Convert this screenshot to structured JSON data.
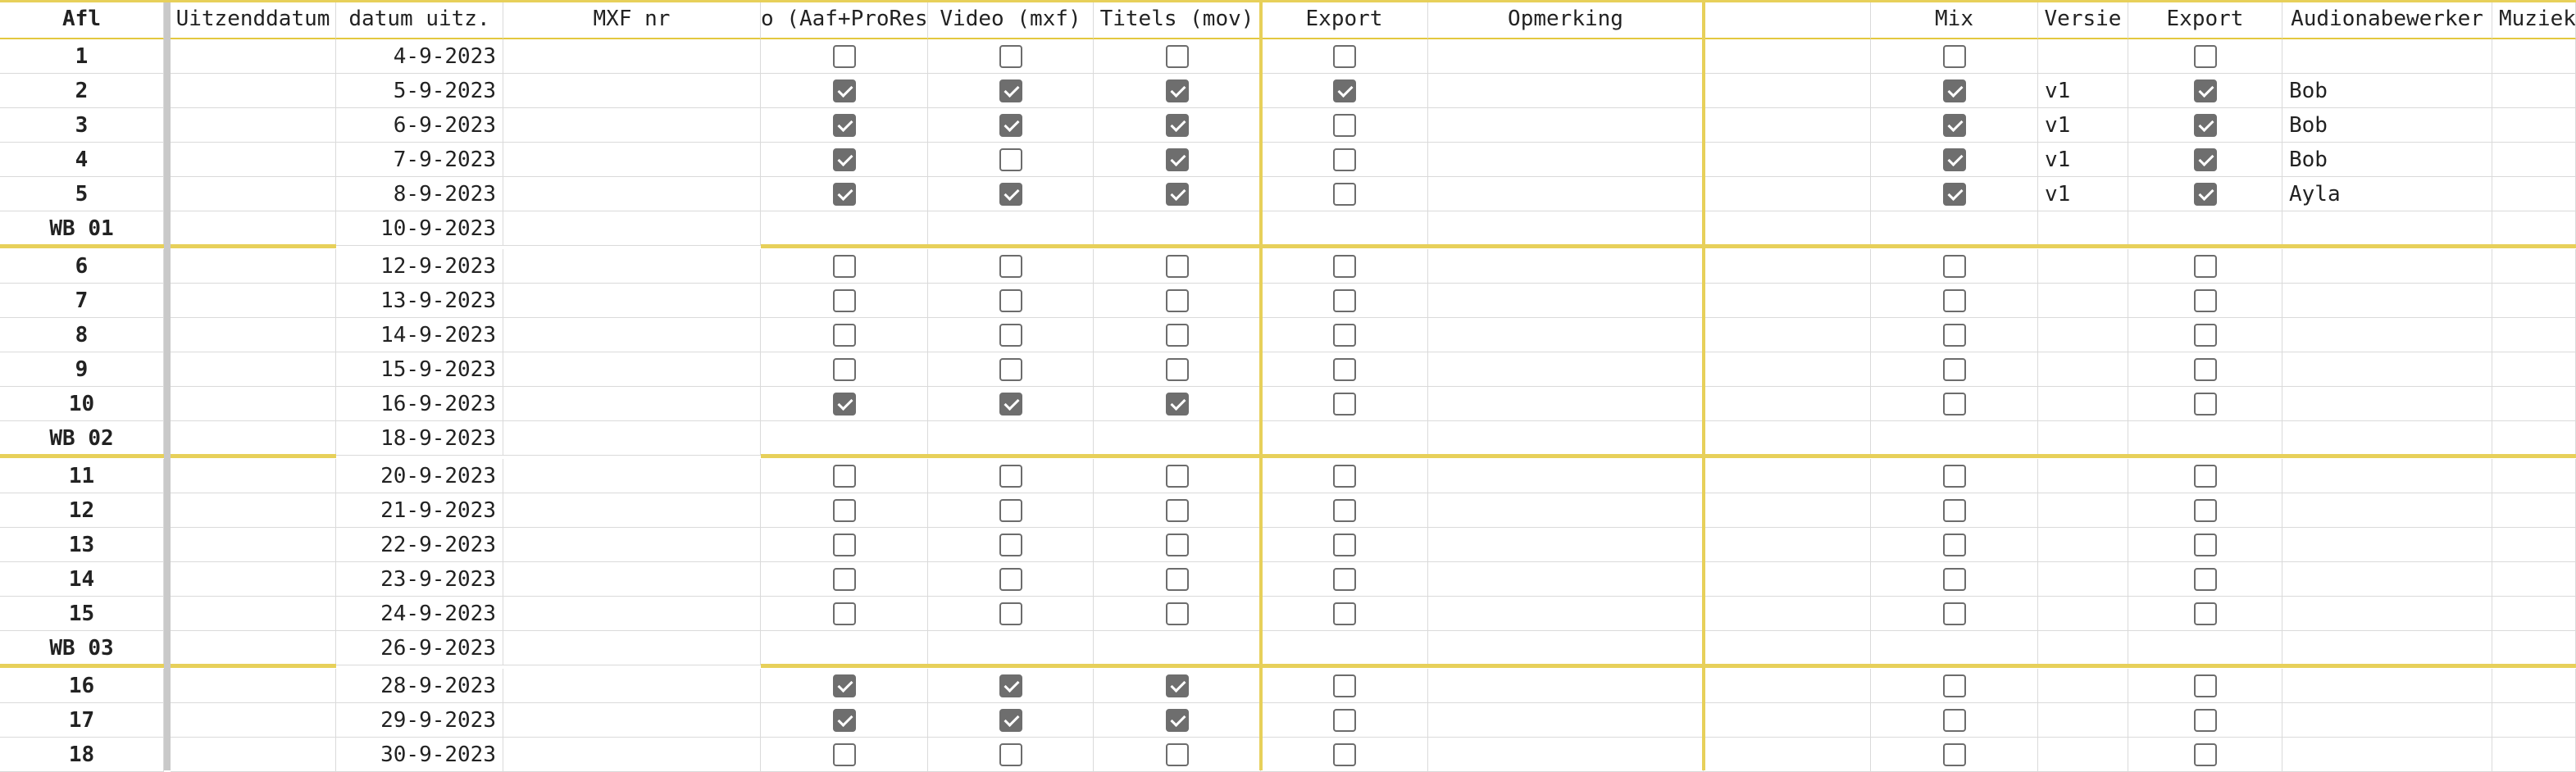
{
  "columns": [
    {
      "key": "afl",
      "label": "Afl",
      "bold": true
    },
    {
      "key": "uitzenddatum",
      "label": "Uitzenddatum"
    },
    {
      "key": "datum_uitz",
      "label": "datum uitz."
    },
    {
      "key": "mxf_nr",
      "label": "MXF nr"
    },
    {
      "key": "aaf",
      "label": "o (Aaf+ProRes"
    },
    {
      "key": "video",
      "label": "Video (mxf)"
    },
    {
      "key": "titels",
      "label": "Titels (mov)"
    },
    {
      "key": "export1",
      "label": "Export"
    },
    {
      "key": "opmerking",
      "label": "Opmerking"
    },
    {
      "key": "blank1",
      "label": ""
    },
    {
      "key": "mix",
      "label": "Mix"
    },
    {
      "key": "versie",
      "label": "Versie"
    },
    {
      "key": "export2",
      "label": "Export"
    },
    {
      "key": "audio",
      "label": "Audionabewerker"
    },
    {
      "key": "muziek",
      "label": "Muziek"
    }
  ],
  "rows": [
    {
      "type": "ep",
      "afl": "1",
      "datum": "4-9-2023",
      "aaf": false,
      "video": false,
      "titels": false,
      "export1": false,
      "mix": false,
      "versie": "",
      "export2": false,
      "audio": ""
    },
    {
      "type": "ep",
      "afl": "2",
      "datum": "5-9-2023",
      "aaf": true,
      "video": true,
      "titels": true,
      "export1": true,
      "mix": true,
      "versie": "v1",
      "export2": true,
      "audio": "Bob"
    },
    {
      "type": "ep",
      "afl": "3",
      "datum": "6-9-2023",
      "aaf": true,
      "video": true,
      "titels": true,
      "export1": false,
      "mix": true,
      "versie": "v1",
      "export2": true,
      "audio": "Bob"
    },
    {
      "type": "ep",
      "afl": "4",
      "datum": "7-9-2023",
      "aaf": true,
      "video": false,
      "titels": true,
      "export1": false,
      "mix": true,
      "versie": "v1",
      "export2": true,
      "audio": "Bob"
    },
    {
      "type": "ep",
      "afl": "5",
      "datum": "8-9-2023",
      "aaf": true,
      "video": true,
      "titels": true,
      "export1": false,
      "mix": true,
      "versie": "v1",
      "export2": true,
      "audio": "Ayla"
    },
    {
      "type": "wb",
      "afl": "WB 01",
      "datum": "10-9-2023"
    },
    {
      "type": "ep",
      "afl": "6",
      "datum": "12-9-2023",
      "aaf": false,
      "video": false,
      "titels": false,
      "export1": false,
      "mix": false,
      "versie": "",
      "export2": false,
      "audio": ""
    },
    {
      "type": "ep",
      "afl": "7",
      "datum": "13-9-2023",
      "aaf": false,
      "video": false,
      "titels": false,
      "export1": false,
      "mix": false,
      "versie": "",
      "export2": false,
      "audio": ""
    },
    {
      "type": "ep",
      "afl": "8",
      "datum": "14-9-2023",
      "aaf": false,
      "video": false,
      "titels": false,
      "export1": false,
      "mix": false,
      "versie": "",
      "export2": false,
      "audio": ""
    },
    {
      "type": "ep",
      "afl": "9",
      "datum": "15-9-2023",
      "aaf": false,
      "video": false,
      "titels": false,
      "export1": false,
      "mix": false,
      "versie": "",
      "export2": false,
      "audio": ""
    },
    {
      "type": "ep",
      "afl": "10",
      "datum": "16-9-2023",
      "aaf": true,
      "video": true,
      "titels": true,
      "export1": false,
      "mix": false,
      "versie": "",
      "export2": false,
      "audio": ""
    },
    {
      "type": "wb",
      "afl": "WB 02",
      "datum": "18-9-2023"
    },
    {
      "type": "ep",
      "afl": "11",
      "datum": "20-9-2023",
      "aaf": false,
      "video": false,
      "titels": false,
      "export1": false,
      "mix": false,
      "versie": "",
      "export2": false,
      "audio": ""
    },
    {
      "type": "ep",
      "afl": "12",
      "datum": "21-9-2023",
      "aaf": false,
      "video": false,
      "titels": false,
      "export1": false,
      "mix": false,
      "versie": "",
      "export2": false,
      "audio": ""
    },
    {
      "type": "ep",
      "afl": "13",
      "datum": "22-9-2023",
      "aaf": false,
      "video": false,
      "titels": false,
      "export1": false,
      "mix": false,
      "versie": "",
      "export2": false,
      "audio": ""
    },
    {
      "type": "ep",
      "afl": "14",
      "datum": "23-9-2023",
      "aaf": false,
      "video": false,
      "titels": false,
      "export1": false,
      "mix": false,
      "versie": "",
      "export2": false,
      "audio": ""
    },
    {
      "type": "ep",
      "afl": "15",
      "datum": "24-9-2023",
      "aaf": false,
      "video": false,
      "titels": false,
      "export1": false,
      "mix": false,
      "versie": "",
      "export2": false,
      "audio": ""
    },
    {
      "type": "wb",
      "afl": "WB 03",
      "datum": "26-9-2023"
    },
    {
      "type": "ep",
      "afl": "16",
      "datum": "28-9-2023",
      "aaf": true,
      "video": true,
      "titels": true,
      "export1": false,
      "mix": false,
      "versie": "",
      "export2": false,
      "audio": ""
    },
    {
      "type": "ep",
      "afl": "17",
      "datum": "29-9-2023",
      "aaf": true,
      "video": true,
      "titels": true,
      "export1": false,
      "mix": false,
      "versie": "",
      "export2": false,
      "audio": ""
    },
    {
      "type": "ep",
      "afl": "18",
      "datum": "30-9-2023",
      "aaf": false,
      "video": false,
      "titels": false,
      "export1": false,
      "mix": false,
      "versie": "",
      "export2": false,
      "audio": ""
    }
  ]
}
